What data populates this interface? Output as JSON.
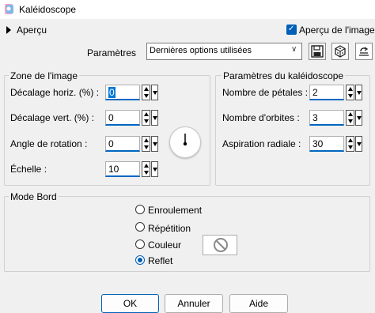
{
  "window": {
    "title": "Kaléidoscope"
  },
  "preview": {
    "label": "Aperçu",
    "checkbox_label": "Aperçu de l'image",
    "checked": true
  },
  "presets": {
    "label": "Paramètres",
    "selected": "Dernières options utilisées"
  },
  "toolbar": {
    "icons": [
      "save-icon",
      "dice-icon",
      "reset-icon"
    ]
  },
  "image_zone": {
    "title": "Zone de l'image",
    "fields": [
      {
        "label": "Décalage horiz. (%) :",
        "value": "0"
      },
      {
        "label": "Décalage vert. (%) :",
        "value": "0"
      },
      {
        "label": "Angle de rotation :",
        "value": "0"
      },
      {
        "label": "Échelle :",
        "value": "10"
      }
    ]
  },
  "kaleidoscope": {
    "title": "Paramètres du kaléidoscope",
    "fields": [
      {
        "label": "Nombre de pétales :",
        "value": "2"
      },
      {
        "label": "Nombre d'orbites :",
        "value": "3"
      },
      {
        "label": "Aspiration radiale :",
        "value": "30"
      }
    ]
  },
  "edge_mode": {
    "title": "Mode Bord",
    "options": [
      "Enroulement",
      "Répétition",
      "Couleur",
      "Reflet"
    ],
    "selected": "Reflet"
  },
  "buttons": {
    "ok": "OK",
    "cancel": "Annuler",
    "help": "Aide"
  },
  "colors": {
    "accent": "#005fb8",
    "background": "#f0f0f0"
  }
}
